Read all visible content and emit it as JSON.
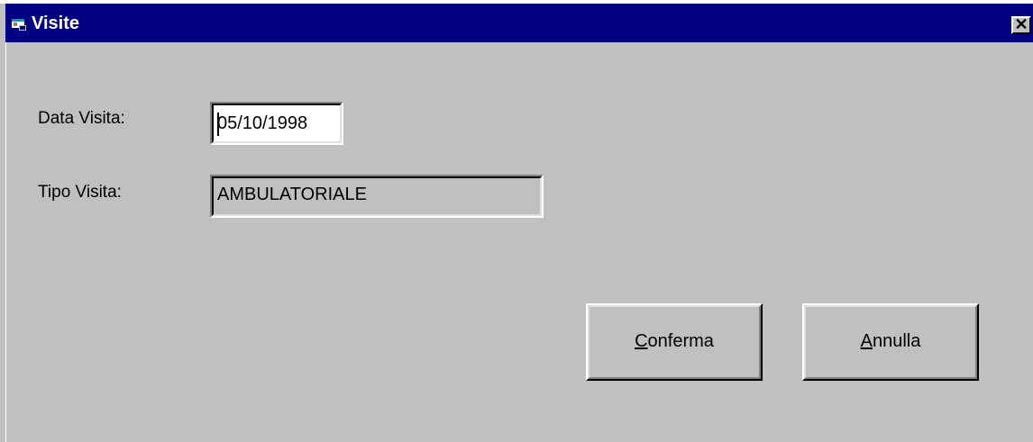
{
  "window": {
    "title": "Visite",
    "close_glyph": "✕",
    "icon": "app-window-icon"
  },
  "form": {
    "data_visita": {
      "label": "Data Visita:",
      "value": "05/10/1998"
    },
    "tipo_visita": {
      "label": "Tipo Visita:",
      "value": "AMBULATORIALE"
    }
  },
  "buttons": {
    "conferma": {
      "accel": "C",
      "rest": "onferma"
    },
    "annulla": {
      "accel": "A",
      "rest": "nnulla"
    }
  },
  "colors": {
    "titlebar": "#000080",
    "face": "#c0c0c0"
  }
}
